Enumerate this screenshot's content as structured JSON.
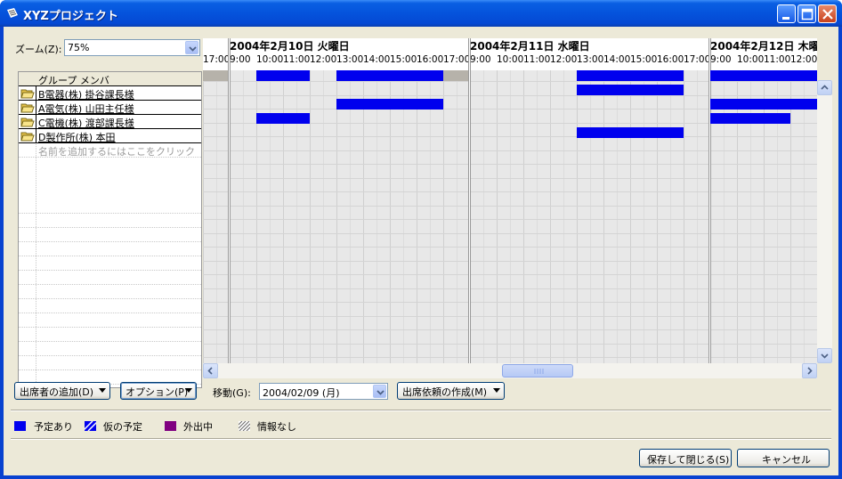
{
  "window": {
    "title": "XYZプロジェクト"
  },
  "zoom": {
    "label": "ズーム(Z):",
    "value": "75%"
  },
  "members": {
    "header": "グループ メンバ",
    "rows": [
      {
        "name": "B電器(株) 掛谷課長様"
      },
      {
        "name": "A電気(株) 山田主任様"
      },
      {
        "name": "C電機(株) 渡部課長様"
      },
      {
        "name": "D製作所(株) 本田"
      }
    ],
    "add_hint": "名前を追加するにはここをクリック"
  },
  "schedule": {
    "dates": [
      "2004年2月10日 火曜日",
      "2004年2月11日 水曜日",
      "2004年2月12日 木曜日"
    ],
    "times": {
      "lead": "17:00",
      "day": [
        "9:00",
        "10:00",
        "11:00",
        "12:00",
        "13:00",
        "14:00",
        "15:00",
        "16:00",
        "17:00"
      ],
      "day3": [
        "9:00",
        "10:00",
        "11:00",
        "12:00"
      ]
    },
    "busy_blocks": [
      {
        "row": 0,
        "day": 0,
        "start": 10,
        "end": 12
      },
      {
        "row": 0,
        "day": 0,
        "start": 13,
        "end": 17
      },
      {
        "row": 0,
        "day": 1,
        "start": 13,
        "end": 17
      },
      {
        "row": 0,
        "day": 2,
        "start": 9,
        "end": 13
      },
      {
        "row": 1,
        "day": 1,
        "start": 13,
        "end": 17
      },
      {
        "row": 2,
        "day": 0,
        "start": 13,
        "end": 17
      },
      {
        "row": 2,
        "day": 2,
        "start": 9,
        "end": 13
      },
      {
        "row": 3,
        "day": 0,
        "start": 10,
        "end": 12
      },
      {
        "row": 3,
        "day": 2,
        "start": 9,
        "end": 12
      },
      {
        "row": 4,
        "day": 1,
        "start": 13,
        "end": 17
      }
    ]
  },
  "buttons": {
    "add_attendee": "出席者の追加(D)",
    "options": "オプション(P)",
    "move_label": "移動(G):",
    "move_date": "2004/02/09 (月)",
    "create_request": "出席依頼の作成(M)",
    "save_close": "保存して閉じる(S)",
    "cancel": "キャンセル"
  },
  "legend": {
    "busy": "予定あり",
    "tentative": "仮の予定",
    "out_of_office": "外出中",
    "no_info": "情報なし"
  },
  "colors": {
    "busy": "#0000ee",
    "out_of_office": "#800080",
    "titlebar": "#0553dc"
  }
}
